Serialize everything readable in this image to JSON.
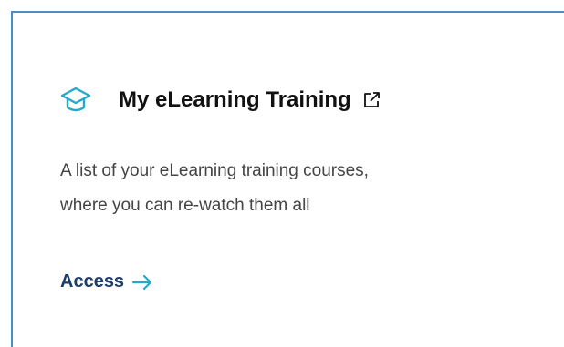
{
  "card": {
    "title": "My eLearning Training",
    "description_line1": "A list of your eLearning training courses,",
    "description_line2": "where you can re-watch them all",
    "access_label": "Access",
    "icons": {
      "title_icon": "graduation-cap-icon",
      "link_icon": "external-link-icon",
      "action_icon": "arrow-right-icon"
    }
  },
  "colors": {
    "accent": "#23a9c9",
    "border": "#4a8fcb",
    "title": "#111111",
    "body_text": "#444444",
    "link": "#1c3c6e"
  }
}
